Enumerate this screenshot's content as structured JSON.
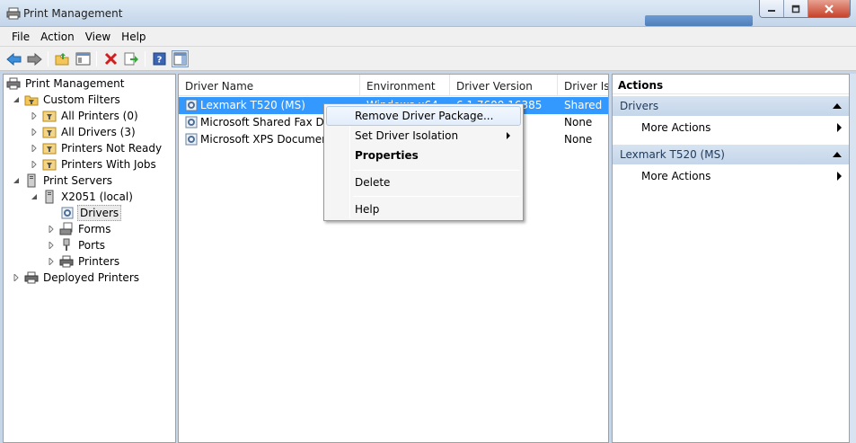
{
  "window": {
    "title": "Print Management"
  },
  "menu": [
    "File",
    "Action",
    "View",
    "Help"
  ],
  "tree": {
    "items": [
      {
        "label": "Print Management",
        "icon": "print-management-icon"
      },
      {
        "label": "Custom Filters",
        "icon": "filter-folder-icon"
      },
      {
        "label": "All Printers (0)",
        "icon": "filter-icon"
      },
      {
        "label": "All Drivers (3)",
        "icon": "filter-icon"
      },
      {
        "label": "Printers Not Ready",
        "icon": "filter-icon"
      },
      {
        "label": "Printers With Jobs",
        "icon": "filter-icon"
      },
      {
        "label": "Print Servers",
        "icon": "server-icon"
      },
      {
        "label": "X2051 (local)",
        "icon": "server-icon"
      },
      {
        "label": "Drivers",
        "icon": "driver-icon"
      },
      {
        "label": "Forms",
        "icon": "forms-icon"
      },
      {
        "label": "Ports",
        "icon": "ports-icon"
      },
      {
        "label": "Printers",
        "icon": "printer-icon"
      },
      {
        "label": "Deployed Printers",
        "icon": "printer-icon"
      }
    ]
  },
  "list": {
    "columns": [
      "Driver Name",
      "Environment",
      "Driver Version",
      "Driver Iso"
    ],
    "rows": [
      {
        "name": "Lexmark T520 (MS)",
        "environment": "Windows x64",
        "version": "6.1.7600.16385",
        "isolation": "Shared"
      },
      {
        "name": "Microsoft Shared Fax Driver",
        "environment": "",
        "version": "",
        "isolation": "None"
      },
      {
        "name": "Microsoft XPS Document Writer",
        "environment": "",
        "version": "",
        "isolation": "None"
      }
    ]
  },
  "context_menu": {
    "items": [
      "Remove Driver Package...",
      "Set Driver Isolation",
      "Properties",
      "Delete",
      "Help"
    ]
  },
  "actions": {
    "title": "Actions",
    "sections": [
      {
        "title": "Drivers",
        "items": [
          "More Actions"
        ]
      },
      {
        "title": "Lexmark T520 (MS)",
        "items": [
          "More Actions"
        ]
      }
    ]
  },
  "colors": {
    "selection": "#3399ff",
    "section_header": "#c9d9ec",
    "close_button": "#c7432a"
  }
}
